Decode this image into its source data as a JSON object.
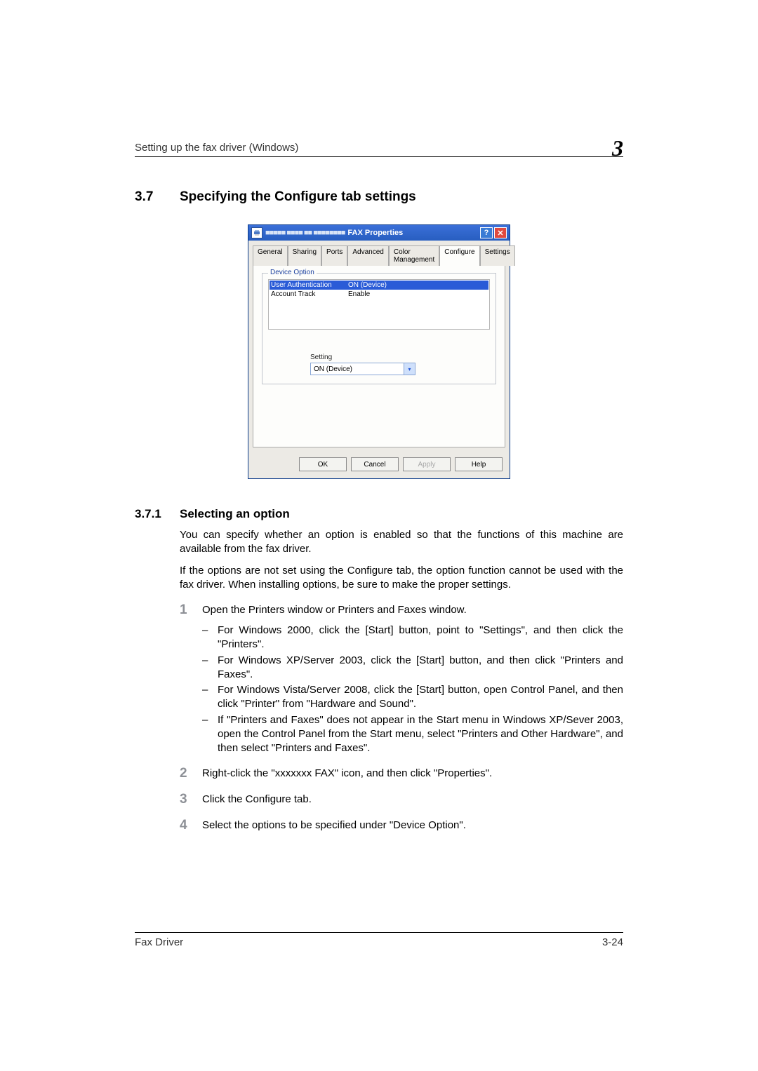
{
  "header": {
    "left": "Setting up the fax driver (Windows)",
    "chapter": "3"
  },
  "section": {
    "num": "3.7",
    "title": "Specifying the Configure tab settings"
  },
  "dialog": {
    "title": "FAX Properties",
    "title_prefix": "■■■■■ ■■■■ ■■ ■■■■■■■■",
    "tabs": [
      "General",
      "Sharing",
      "Ports",
      "Advanced",
      "Color Management",
      "Configure",
      "Settings"
    ],
    "active_tab": 5,
    "group": "Device Option",
    "options": [
      {
        "k": "User Authentication",
        "v": "ON (Device)",
        "sel": true
      },
      {
        "k": "Account Track",
        "v": "Enable",
        "sel": false
      }
    ],
    "setting_label": "Setting",
    "combo_value": "ON (Device)",
    "buttons": {
      "ok": "OK",
      "cancel": "Cancel",
      "apply": "Apply",
      "help": "Help"
    }
  },
  "subsection": {
    "num": "3.7.1",
    "title": "Selecting an option"
  },
  "para1": "You can specify whether an option is enabled so that the functions of this machine are available from the fax driver.",
  "para2": "If the options are not set using the Configure tab, the option function cannot be used with the fax driver. When installing options, be sure to make the proper settings.",
  "steps": {
    "s1": "Open the Printers window or Printers and Faxes window.",
    "sub": [
      "For Windows 2000, click the [Start] button, point to \"Settings\", and then click the \"Printers\".",
      "For Windows XP/Server 2003, click the [Start] button, and then click \"Printers and Faxes\".",
      "For Windows Vista/Server 2008, click the [Start] button, open Control Panel, and then click \"Printer\" from \"Hardware and Sound\".",
      "If \"Printers and Faxes\" does not appear in the Start menu in Windows XP/Sever 2003, open the Control Panel from the Start menu, select \"Printers and Other Hardware\", and then select \"Printers and Faxes\"."
    ],
    "s2": "Right-click the \"xxxxxxx FAX\" icon, and then click \"Properties\".",
    "s3": "Click the Configure tab.",
    "s4": "Select the options to be specified under \"Device Option\"."
  },
  "footer": {
    "left": "Fax Driver",
    "right": "3-24"
  }
}
